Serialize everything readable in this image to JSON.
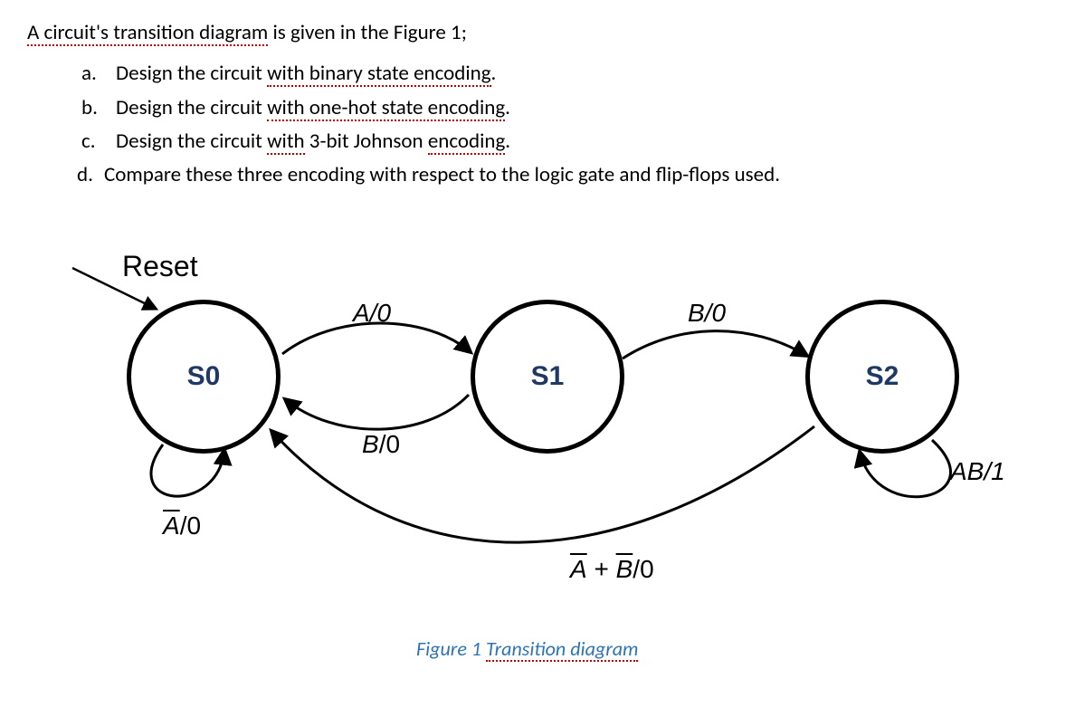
{
  "intro": {
    "w1": "A circuit's transition diagram",
    "rest": " is given in the Figure 1;"
  },
  "items": {
    "a_lbl": "a.",
    "a_t1": "Design the circuit ",
    "a_u1": "with binary state encoding",
    "a_t2": ".",
    "b_lbl": "b.",
    "b_t1": "Design the circuit ",
    "b_u1": "with one-hot state encoding",
    "b_t2": ".",
    "c_lbl": "c.",
    "c_t1": "Design the circuit ",
    "c_u1": "with",
    "c_t2": " 3-bit Johnson ",
    "c_u2": "encoding",
    "c_t3": ".",
    "d_lbl": "d.",
    "d_t1": "Compare these three encoding with respect to the logic gate and flip-flops used."
  },
  "diagram": {
    "reset": "Reset",
    "s0": "S0",
    "s1": "S1",
    "s2": "S2",
    "edge_s0_s1": "A/0",
    "edge_s1_s0_B": "B",
    "edge_s1_s0_rest": "/0",
    "edge_s1_s2": "B/0",
    "edge_s0_self_A": "A",
    "edge_s0_self_rest": "/0",
    "edge_s2_self": "AB/1",
    "edge_s2_s0_A": "A",
    "edge_s2_s0_plus": " + ",
    "edge_s2_s0_B": "B",
    "edge_s2_s0_rest": "/0",
    "caption_pre": "Figure 1 ",
    "caption_u": "Transition diagram"
  }
}
